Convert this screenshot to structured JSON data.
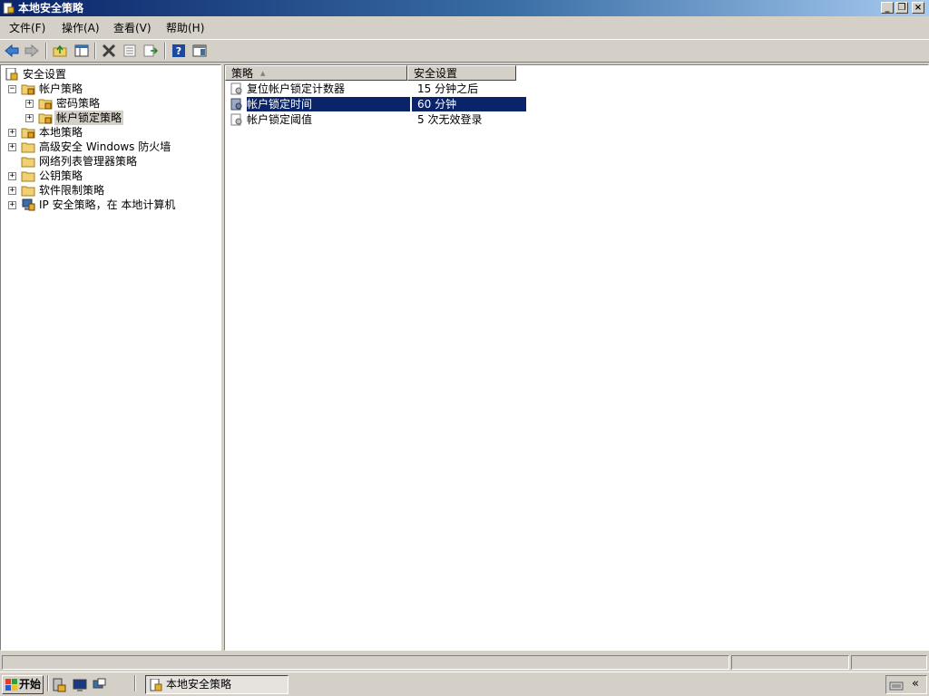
{
  "window": {
    "title": "本地安全策略"
  },
  "menu": [
    "文件(F)",
    "操作(A)",
    "查看(V)",
    "帮助(H)"
  ],
  "toolbar": {
    "buttons": [
      "back-icon",
      "forward-icon",
      "up-folder-icon",
      "show-hide-tree-icon",
      "delete-icon",
      "properties-icon",
      "export-list-icon",
      "help-icon",
      "console-view-icon"
    ]
  },
  "tree": {
    "root": "安全设置",
    "items": [
      {
        "label": "帐户策略",
        "expander": "−"
      },
      {
        "label": "密码策略",
        "expander": "+"
      },
      {
        "label": "帐户锁定策略",
        "expander": "+"
      },
      {
        "label": "本地策略",
        "expander": "+"
      },
      {
        "label": "高级安全 Windows 防火墙",
        "expander": "+"
      },
      {
        "label": "网络列表管理器策略",
        "expander": ""
      },
      {
        "label": "公钥策略",
        "expander": "+"
      },
      {
        "label": "软件限制策略",
        "expander": "+"
      },
      {
        "label": "IP 安全策略，在 本地计算机",
        "expander": "+"
      }
    ]
  },
  "list": {
    "columns": [
      "策略",
      "安全设置"
    ],
    "sort_indicator": "▲",
    "rows": [
      {
        "policy": "复位帐户锁定计数器",
        "setting": "15 分钟之后",
        "selected": false
      },
      {
        "policy": "帐户锁定时间",
        "setting": "60 分钟",
        "selected": true
      },
      {
        "policy": "帐户锁定阈值",
        "setting": "5 次无效登录",
        "selected": false
      }
    ]
  },
  "taskbar": {
    "start_label": "开始",
    "active_window": "本地安全策略",
    "tray_chevron": "«"
  },
  "window_controls": {
    "minimize": "_",
    "restore": "❐",
    "close": "×"
  },
  "colors": {
    "selection": "#0a246a",
    "title_gradient_start": "#0a246a",
    "title_gradient_end": "#a6caf0",
    "face": "#d4d0c8"
  }
}
